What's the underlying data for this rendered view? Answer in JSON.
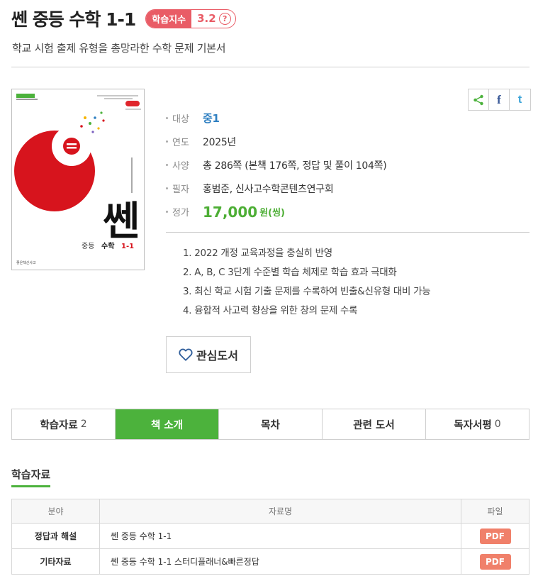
{
  "book": {
    "title": "쎈 중등 수학 1-1",
    "subtitle": "학교 시험 출제 유형을 총망라한 수학 문제 기본서",
    "badge": {
      "label": "학습지수",
      "value": "3.2",
      "help": "?"
    }
  },
  "cover": {
    "brand": "쎈",
    "series": "중등",
    "subject": "수학",
    "grade": "1-1",
    "publisher": "좋은책신사고"
  },
  "share": {
    "icons": [
      "share-icon",
      "facebook-icon",
      "twitter-icon"
    ],
    "facebook_glyph": "f",
    "twitter_glyph": "t"
  },
  "info": {
    "target": {
      "label": "대상",
      "value": "중1"
    },
    "year": {
      "label": "연도",
      "value": "2025년"
    },
    "spec": {
      "label": "사양",
      "value": "총 286쪽 (본책 176쪽, 정답 및 풀이 104쪽)"
    },
    "author": {
      "label": "필자",
      "value": "홍범준, 신사고수학콘텐츠연구회"
    },
    "price": {
      "label": "정가",
      "value": "17,000",
      "unit": "원(씽)"
    }
  },
  "features": [
    "1. 2022 개정 교육과정을 충실히 반영",
    "2. A, B, C 3단계 수준별 학습 체제로 학습 효과 극대화",
    "3. 최신 학교 시험 기출 문제를 수록하여 빈출&신유형 대비 가능",
    "4. 융합적 사고력 향상을 위한 창의 문제 수록"
  ],
  "wishlist": {
    "label": "관심도서"
  },
  "tabs": [
    {
      "label": "학습자료",
      "count": "2",
      "active": false
    },
    {
      "label": "책 소개",
      "count": "",
      "active": true
    },
    {
      "label": "목차",
      "count": "",
      "active": false
    },
    {
      "label": "관련 도서",
      "count": "",
      "active": false
    },
    {
      "label": "독자서평",
      "count": "0",
      "active": false
    }
  ],
  "materials": {
    "section_title": "학습자료",
    "headers": [
      "분야",
      "자료명",
      "파일"
    ],
    "rows": [
      {
        "category": "정답과 해설",
        "name": "쎈 중등 수학 1-1",
        "file": "PDF"
      },
      {
        "category": "기타자료",
        "name": "쎈 중등 수학 1-1 스터디플래너&빠른정답",
        "file": "PDF"
      }
    ]
  },
  "colors": {
    "accent_green": "#4cb23c",
    "badge_red": "#e95c66",
    "link_blue": "#2e7fc1",
    "pdf_orange": "#f0806a",
    "cover_red": "#d7141d"
  }
}
